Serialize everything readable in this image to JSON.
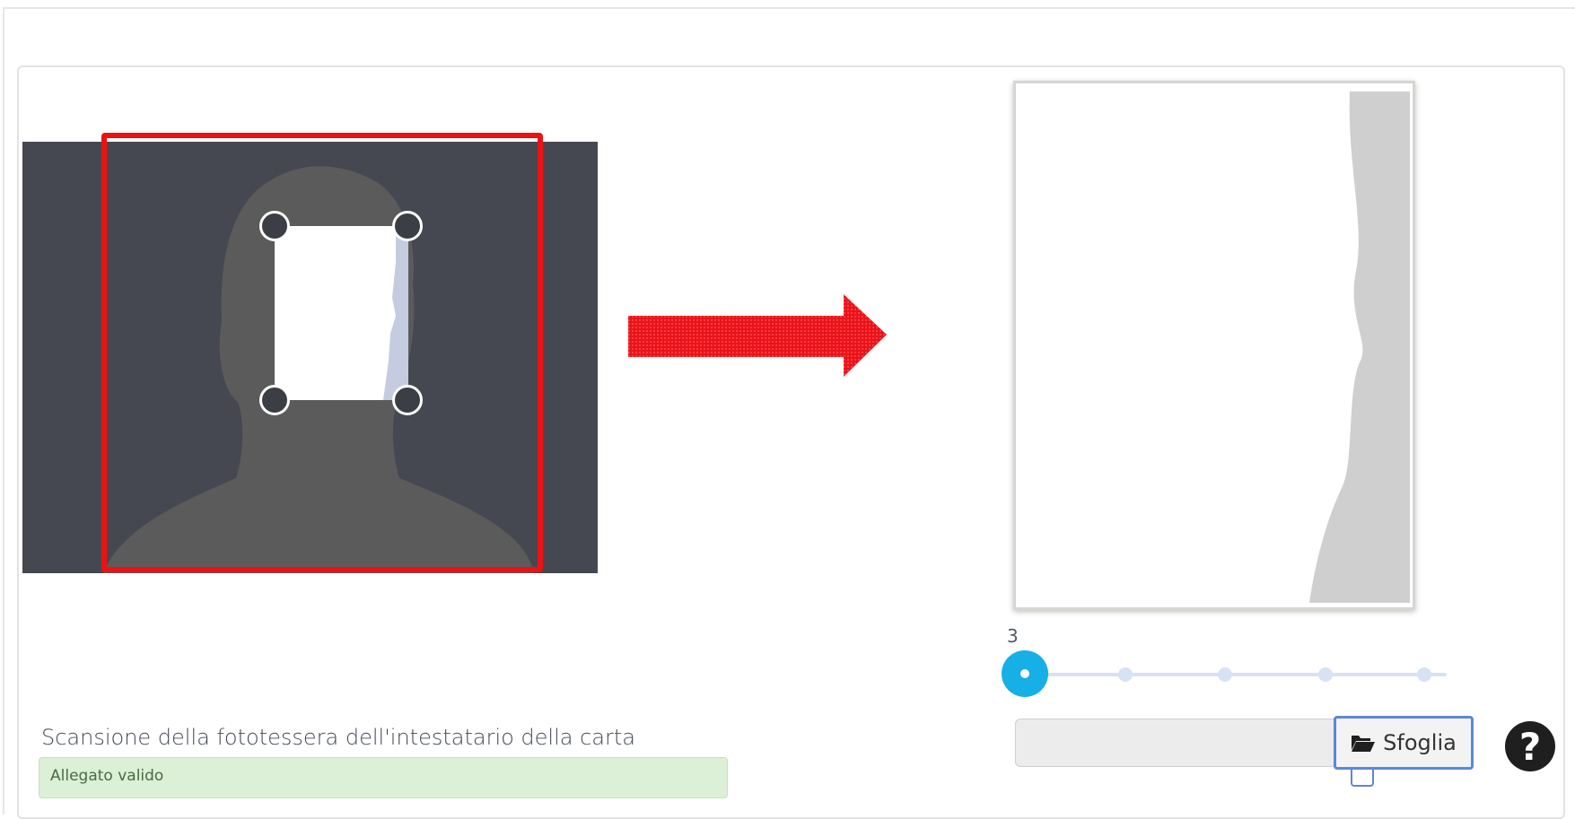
{
  "field": {
    "label": "Scansione della fototessera dell'intestatario della carta",
    "status": "Allegato valido"
  },
  "slider": {
    "value": "3",
    "fraction": 0.0
  },
  "file_input": {
    "value": "",
    "browse_label": "Sfoglia",
    "browse_icon": "folder-open-icon"
  },
  "help": {
    "symbol": "?",
    "icon": "question-circle-icon"
  },
  "colors": {
    "highlight": "#ee1111",
    "slider_accent": "#16afe6",
    "status_bg": "#dcefd7",
    "crop_bg": "#454850"
  }
}
